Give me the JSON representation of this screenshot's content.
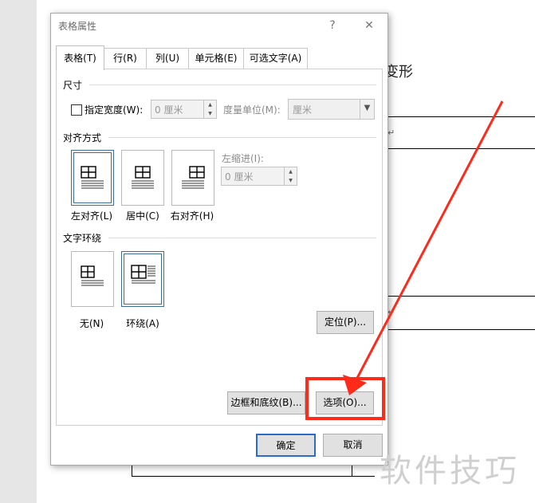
{
  "document": {
    "partial_text": "变形",
    "para_mark": "↵",
    "watermark": "软件技巧"
  },
  "dialog": {
    "title": "表格属性",
    "help_label": "?",
    "close_label": "✕",
    "tabs": [
      {
        "label": "表格(T)"
      },
      {
        "label": "行(R)"
      },
      {
        "label": "列(U)"
      },
      {
        "label": "单元格(E)"
      },
      {
        "label": "可选文字(A)"
      }
    ],
    "size_section": {
      "heading": "尺寸",
      "preferred_width_label": "指定宽度(W):",
      "preferred_width_value": "0 厘米",
      "measure_label": "度量单位(M):",
      "measure_value": "厘米"
    },
    "alignment_section": {
      "heading": "对齐方式",
      "options": [
        {
          "label": "左对齐(L)",
          "selected": true
        },
        {
          "label": "居中(C)",
          "selected": false
        },
        {
          "label": "右对齐(H)",
          "selected": false
        }
      ],
      "indent_label": "左缩进(I):",
      "indent_value": "0 厘米"
    },
    "wrap_section": {
      "heading": "文字环绕",
      "options": [
        {
          "label": "无(N)",
          "selected": false
        },
        {
          "label": "环绕(A)",
          "selected": true
        }
      ],
      "positioning_button": "定位(P)..."
    },
    "borders_button": "边框和底纹(B)...",
    "options_button": "选项(O)...",
    "ok_button": "确定",
    "cancel_button": "取消"
  },
  "colors": {
    "highlight": "#ff2a1a",
    "selected_border": "#3c6f9a",
    "default_button_border": "#2a6cc8"
  }
}
